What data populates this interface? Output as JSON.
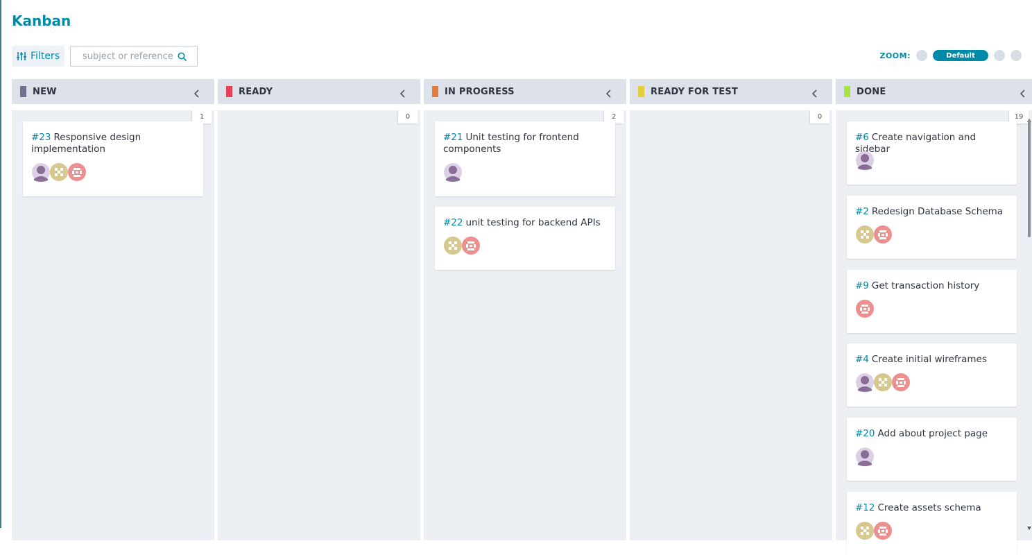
{
  "page": {
    "title": "Kanban"
  },
  "toolbar": {
    "filters_label": "Filters",
    "search_placeholder": "subject or reference",
    "search_value": "",
    "zoom_label": "ZOOM:",
    "zoom_selected": "Default"
  },
  "colors": {
    "accent": "#008aa8",
    "status_new": "#6f6f8e",
    "status_ready": "#e44057",
    "status_in_progress": "#e47c40",
    "status_ready_for_test": "#e4ce40",
    "status_done": "#a8e440"
  },
  "columns": [
    {
      "title": "NEW",
      "count": "1",
      "cards": [
        {
          "ref": "#23",
          "subject": "Responsive design implementation",
          "avatars": [
            "person-avatar",
            "gold-avatar",
            "pink-avatar"
          ]
        }
      ]
    },
    {
      "title": "READY",
      "count": "0",
      "cards": []
    },
    {
      "title": "IN PROGRESS",
      "count": "2",
      "cards": [
        {
          "ref": "#21",
          "subject": "Unit testing for frontend components",
          "avatars": [
            "person-avatar"
          ]
        },
        {
          "ref": "#22",
          "subject": "unit testing for backend APIs",
          "avatars": [
            "gold-avatar",
            "pink-avatar"
          ]
        }
      ]
    },
    {
      "title": "READY FOR TEST",
      "count": "0",
      "cards": []
    },
    {
      "title": "DONE",
      "count": "19",
      "cards": [
        {
          "ref": "#6",
          "subject": "Create navigation and sidebar",
          "avatars": [
            "person-avatar"
          ]
        },
        {
          "ref": "#2",
          "subject": "Redesign Database Schema",
          "avatars": [
            "gold-avatar",
            "pink-avatar"
          ]
        },
        {
          "ref": "#9",
          "subject": "Get transaction history",
          "avatars": [
            "pink-avatar"
          ]
        },
        {
          "ref": "#4",
          "subject": "Create initial wireframes",
          "avatars": [
            "person-avatar",
            "gold-avatar",
            "pink-avatar"
          ]
        },
        {
          "ref": "#20",
          "subject": "Add about project page",
          "avatars": [
            "person-avatar"
          ]
        },
        {
          "ref": "#12",
          "subject": "Create assets schema",
          "avatars": [
            "gold-avatar",
            "pink-avatar"
          ]
        }
      ]
    }
  ]
}
